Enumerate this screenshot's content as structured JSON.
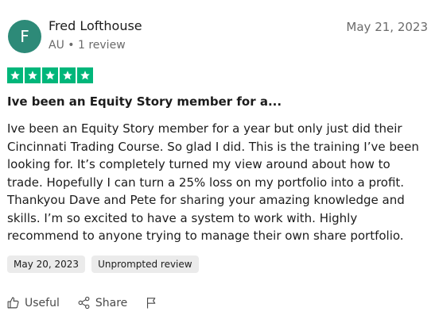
{
  "review": {
    "author": {
      "initial": "F",
      "name": "Fred Lofthouse",
      "meta": "AU • 1 review",
      "avatar_color": "#2d8a78"
    },
    "date": "May 21, 2023",
    "rating": 5,
    "star_color": "#00b67a",
    "title": "Ive been an Equity Story member for a...",
    "body": "Ive been an Equity Story member for a year but only just did their Cincinnati Trading Course. So glad I did. This is the training I’ve been looking for. It’s completely turned my view around about how to trade. Hopefully I can turn a 25% loss on my portfolio into a profit. Thankyou Dave and Pete for sharing your amazing knowledge and skills. I’m so excited to have a system to work with. Highly recommend to anyone trying to manage their own share portfolio.",
    "tags": {
      "date_of_experience": "May 20, 2023",
      "unprompted": "Unprompted review"
    }
  },
  "actions": {
    "useful_label": "Useful",
    "useful_icon": "thumbs-up-icon",
    "share_label": "Share",
    "share_icon": "share-icon",
    "flag_icon": "flag-icon"
  }
}
